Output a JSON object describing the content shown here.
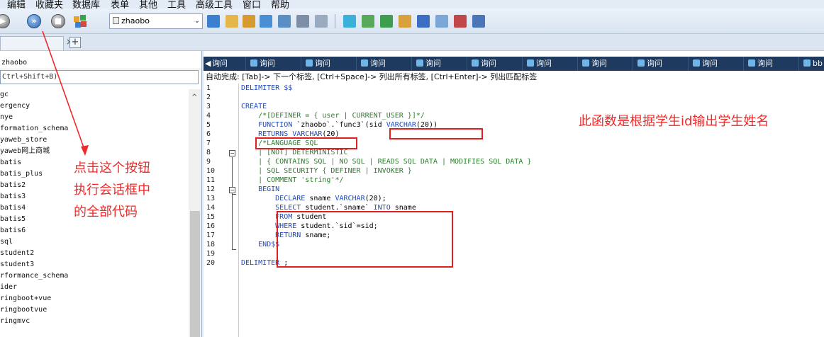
{
  "menu": {
    "items": [
      "编辑",
      "收藏夹",
      "数据库",
      "表单",
      "其他",
      "工具",
      "高级工具",
      "窗口",
      "帮助"
    ]
  },
  "toolbar": {
    "database_select": "zhaobo"
  },
  "tabs": {
    "plus_label": "+",
    "close_label": "×"
  },
  "sidebar": {
    "connection_label": "zhaobo",
    "filter_placeholder": "Ctrl+Shift+B)",
    "databases": [
      "gc",
      "ergency",
      "nye",
      "formation_schema",
      "yaweb_store",
      "yaweb网上商城",
      "batis",
      "batis_plus",
      "batis2",
      "batis3",
      "batis4",
      "batis5",
      "batis6",
      "sql",
      "student2",
      "student3",
      "rformance_schema",
      "ider",
      "ringboot+vue",
      "ringbootvue",
      "ringmvc"
    ]
  },
  "editor": {
    "query_tabs": [
      "询问",
      "询问",
      "询问",
      "询问",
      "询问",
      "询问",
      "询问",
      "询问",
      "询问",
      "询问",
      "询问",
      "bb"
    ],
    "autocomplete_hint": "自动完成: [Tab]-> 下一个标签, [Ctrl+Space]-> 列出所有标签, [Ctrl+Enter]-> 列出匹配标签",
    "line_numbers": [
      "1",
      "2",
      "3",
      "4",
      "5",
      "6",
      "7",
      "8",
      "9",
      "10",
      "11",
      "12",
      "13",
      "14",
      "15",
      "16",
      "17",
      "18",
      "19",
      "20"
    ],
    "code": [
      {
        "parts": [
          {
            "c": "kw",
            "t": "DELIMITER $$"
          }
        ]
      },
      {
        "parts": []
      },
      {
        "parts": [
          {
            "c": "kw",
            "t": "CREATE"
          }
        ]
      },
      {
        "parts": [
          {
            "c": "cm",
            "t": "    /*[DEFINER = { user | CURRENT_USER }]*/"
          }
        ]
      },
      {
        "parts": [
          {
            "c": "kw",
            "t": "    FUNCTION "
          },
          {
            "c": "tx",
            "t": "`zhaobo`.`func3`("
          },
          {
            "c": "tx",
            "t": "sid "
          },
          {
            "c": "kw",
            "t": "VARCHAR"
          },
          {
            "c": "tx",
            "t": "(20))"
          }
        ]
      },
      {
        "parts": [
          {
            "c": "kw",
            "t": "    RETURNS VARCHAR"
          },
          {
            "c": "tx",
            "t": "(20)"
          }
        ]
      },
      {
        "parts": [
          {
            "c": "cm",
            "t": "    /*LANGUAGE SQL"
          }
        ]
      },
      {
        "parts": [
          {
            "c": "cm",
            "t": "    | [NOT] DETERMINISTIC"
          }
        ]
      },
      {
        "parts": [
          {
            "c": "cm",
            "t": "    | { CONTAINS SQL | NO SQL | READS SQL DATA | MODIFIES SQL DATA }"
          }
        ]
      },
      {
        "parts": [
          {
            "c": "cm",
            "t": "    | SQL SECURITY { DEFINER | INVOKER }"
          }
        ]
      },
      {
        "parts": [
          {
            "c": "cm",
            "t": "    | COMMENT 'string'*/"
          }
        ]
      },
      {
        "parts": [
          {
            "c": "kw",
            "t": "    BEGIN"
          }
        ]
      },
      {
        "parts": [
          {
            "c": "kw",
            "t": "        DECLARE "
          },
          {
            "c": "tx",
            "t": "sname "
          },
          {
            "c": "kw",
            "t": "VARCHAR"
          },
          {
            "c": "tx",
            "t": "(20);"
          }
        ]
      },
      {
        "parts": [
          {
            "c": "kw",
            "t": "        SELECT "
          },
          {
            "c": "tx",
            "t": "student.`sname` "
          },
          {
            "c": "kw",
            "t": "INTO "
          },
          {
            "c": "tx",
            "t": "sname"
          }
        ]
      },
      {
        "parts": [
          {
            "c": "kw",
            "t": "        FROM "
          },
          {
            "c": "tx",
            "t": "student"
          }
        ]
      },
      {
        "parts": [
          {
            "c": "kw",
            "t": "        WHERE "
          },
          {
            "c": "tx",
            "t": "student.`sid`=sid;"
          }
        ]
      },
      {
        "parts": [
          {
            "c": "kw",
            "t": "        RETURN "
          },
          {
            "c": "tx",
            "t": "sname;"
          }
        ]
      },
      {
        "parts": [
          {
            "c": "kw",
            "t": "    END$$"
          }
        ]
      },
      {
        "parts": []
      },
      {
        "parts": [
          {
            "c": "kw",
            "t": "DELIMITER "
          },
          {
            "c": "tx",
            "t": ";"
          }
        ]
      }
    ]
  },
  "annotations": {
    "left_line1": "点击这个按钮",
    "left_line2": "执行会话框中",
    "left_line3": "的全部代码",
    "right": "此函数是根据学生id输出学生姓名",
    "color": "#ee2a2a"
  }
}
